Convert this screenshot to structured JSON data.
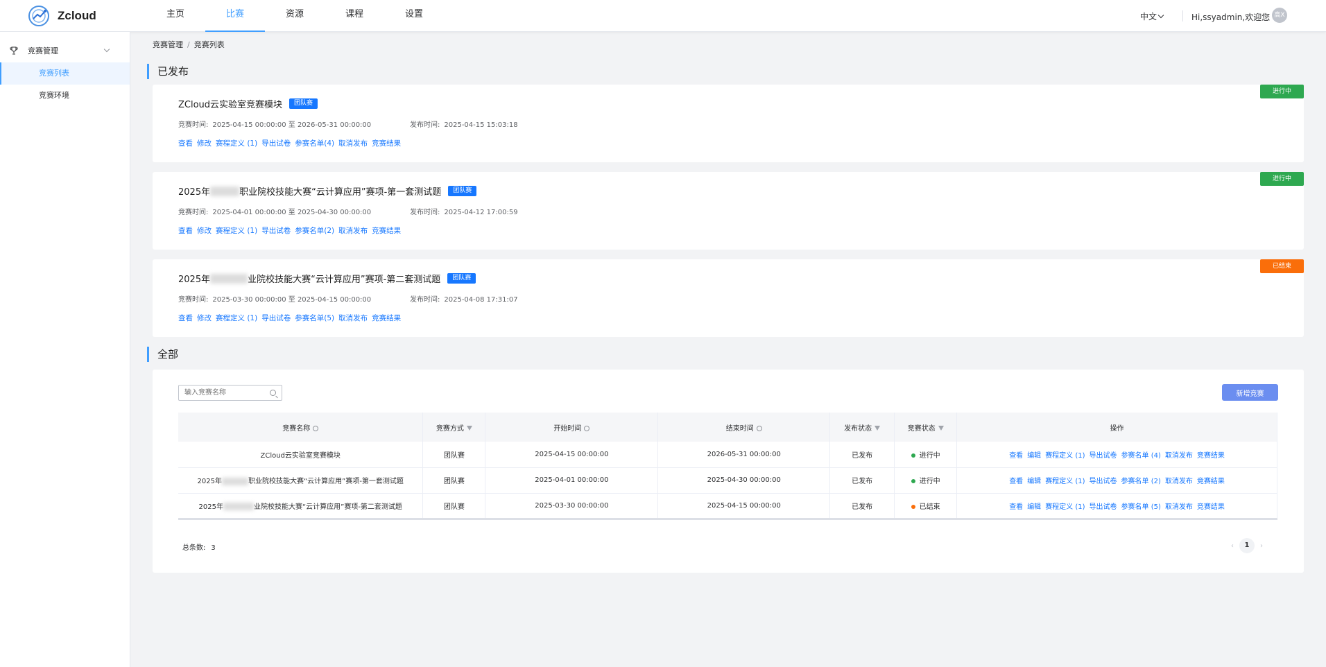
{
  "app": {
    "name": "Zcloud"
  },
  "nav": [
    {
      "label": "主页",
      "active": false
    },
    {
      "label": "比赛",
      "active": true
    },
    {
      "label": "资源",
      "active": false
    },
    {
      "label": "课程",
      "active": false
    },
    {
      "label": "设置",
      "active": false
    }
  ],
  "header": {
    "lang": "中文",
    "greeting": "Hi,ssyadmin,欢迎您",
    "avatar_text": "高X"
  },
  "sidebar": {
    "group_label": "竞赛管理",
    "items": [
      {
        "label": "竞赛列表",
        "active": true
      },
      {
        "label": "竞赛环境",
        "active": false
      }
    ]
  },
  "breadcrumb": [
    "竞赛管理",
    "竞赛列表"
  ],
  "published": {
    "title": "已发布",
    "cards": [
      {
        "title": "ZCloud云实验室竞赛模块",
        "title_prefix": "",
        "title_suffix": "",
        "tag": "团队赛",
        "time_label": "竞赛时间:",
        "time_value": "2025-04-15 00:00:00 至 2026-05-31 00:00:00",
        "pub_label": "发布时间:",
        "pub_value": "2025-04-15 15:03:18",
        "status": "进行中",
        "status_color": "#2ea850",
        "links": [
          "查看",
          "修改",
          "赛程定义 (1)",
          "导出试卷",
          "参赛名单(4)",
          "取消发布",
          "竞赛结果"
        ]
      },
      {
        "title": "",
        "title_prefix": "2025年",
        "title_suffix": "职业院校技能大赛“云计算应用”赛项-第一套测试题",
        "tag": "团队赛",
        "time_label": "竞赛时间:",
        "time_value": "2025-04-01 00:00:00 至 2025-04-30 00:00:00",
        "pub_label": "发布时间:",
        "pub_value": "2025-04-12 17:00:59",
        "status": "进行中",
        "status_color": "#2ea850",
        "links": [
          "查看",
          "修改",
          "赛程定义 (1)",
          "导出试卷",
          "参赛名单(2)",
          "取消发布",
          "竞赛结果"
        ]
      },
      {
        "title": "",
        "title_prefix": "2025年",
        "title_suffix": "业院校技能大赛“云计算应用”赛项-第二套测试题",
        "tag": "团队赛",
        "time_label": "竞赛时间:",
        "time_value": "2025-03-30 00:00:00 至 2025-04-15 00:00:00",
        "pub_label": "发布时间:",
        "pub_value": "2025-04-08 17:31:07",
        "status": "已结束",
        "status_color": "#fa6e0a",
        "links": [
          "查看",
          "修改",
          "赛程定义 (1)",
          "导出试卷",
          "参赛名单(5)",
          "取消发布",
          "竞赛结果"
        ]
      }
    ]
  },
  "all": {
    "title": "全部",
    "search_placeholder": "输入竞赛名称",
    "add_button": "新增竞赛",
    "columns": [
      "竞赛名称",
      "竞赛方式",
      "开始时间",
      "结束时间",
      "发布状态",
      "竞赛状态",
      "操作"
    ],
    "rows": [
      {
        "name_prefix": "ZCloud云实验室竞赛模块",
        "name_suffix": "",
        "blurred": false,
        "mode": "团队赛",
        "start": "2025-04-15 00:00:00",
        "end": "2026-05-31 00:00:00",
        "pub": "已发布",
        "status": "进行中",
        "status_color": "#2ea850",
        "ops": [
          "查看",
          "编辑",
          "赛程定义 (1)",
          "导出试卷",
          "参赛名单 (4)",
          "取消发布",
          "竞赛结果"
        ]
      },
      {
        "name_prefix": "2025年",
        "name_suffix": "职业院校技能大赛“云计算应用”赛项-第一套测试题",
        "blurred": true,
        "mode": "团队赛",
        "start": "2025-04-01 00:00:00",
        "end": "2025-04-30 00:00:00",
        "pub": "已发布",
        "status": "进行中",
        "status_color": "#2ea850",
        "ops": [
          "查看",
          "编辑",
          "赛程定义 (1)",
          "导出试卷",
          "参赛名单 (2)",
          "取消发布",
          "竞赛结果"
        ]
      },
      {
        "name_prefix": "2025年",
        "name_suffix": "业院校技能大赛“云计算应用”赛项-第二套测试题",
        "blurred": true,
        "mode": "团队赛",
        "start": "2025-03-30 00:00:00",
        "end": "2025-04-15 00:00:00",
        "pub": "已发布",
        "status": "已结束",
        "status_color": "#fa6e0a",
        "ops": [
          "查看",
          "编辑",
          "赛程定义 (1)",
          "导出试卷",
          "参赛名单 (5)",
          "取消发布",
          "竞赛结果"
        ]
      }
    ],
    "total_label": "总条数:",
    "total": "3",
    "page": "1"
  }
}
